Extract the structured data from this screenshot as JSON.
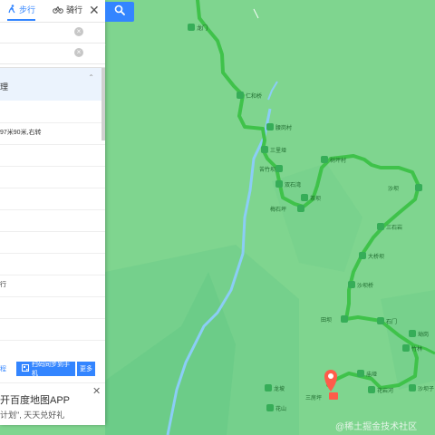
{
  "header": {
    "tabs": [
      {
        "label": "步行",
        "icon": "walk-icon",
        "active": true
      },
      {
        "label": "骑行",
        "icon": "bike-icon",
        "active": false
      }
    ],
    "close_label": "✕",
    "search_icon": "search-icon"
  },
  "route": {
    "summary": "理",
    "steps": [
      "",
      "97米90米,右转",
      "",
      "",
      "",
      "",
      "",
      "",
      "行",
      "",
      "",
      "",
      "",
      ""
    ]
  },
  "toolbar": {
    "left_label": "程",
    "send_label": "扫码同步到手机",
    "more_label": "更多"
  },
  "promo": {
    "title": "开百度地图APP",
    "subtitle": "计划\", 天天兑好礼",
    "close_label": "✕"
  },
  "map": {
    "labels": [
      "龙门",
      "",
      "仁和桥",
      "腰岗村",
      "三里垭",
      "苦竹坝",
      "双石湾",
      "梅石坪",
      "茶坝",
      "树坪村",
      "坪",
      "沙坝",
      "三石岩",
      "大桥坝",
      "沙坝桥",
      "田坝",
      "石门",
      "坳岗",
      "竹林",
      "庙垭",
      "花岩河",
      "沙坝子",
      "龙坡",
      "花山",
      "三房坪",
      "新坝"
    ],
    "colors": {
      "land": "#7fd58f",
      "forest": "#6cc988",
      "route": "#3fc24a",
      "river": "#7cc7f7",
      "poi": "#3aae5a",
      "marker": "#ff5c4a"
    },
    "watermark": "@稀土掘金技术社区"
  }
}
